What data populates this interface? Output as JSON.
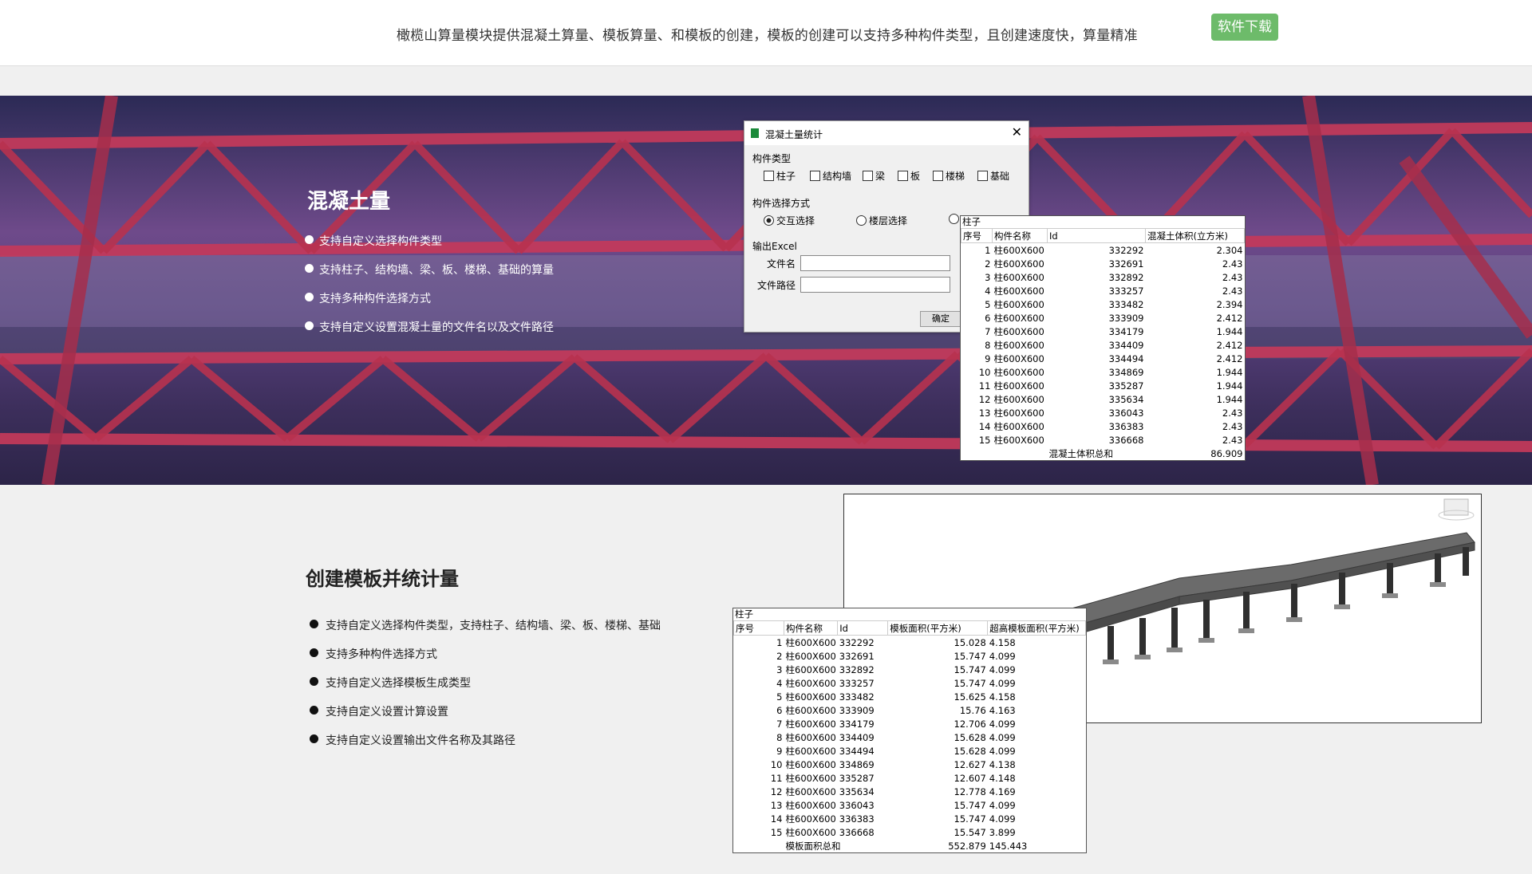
{
  "header": {
    "tagline": "橄榄山算量模块提供混凝土算量、模板算量、和模板的创建，模板的创建可以支持多种构件类型，且创建速度快，算量精准",
    "download_label": "软件下载"
  },
  "hero": {
    "title": "混凝土量",
    "features": [
      "支持自定义选择构件类型",
      "支持柱子、结构墙、梁、板、楼梯、基础的算量",
      "支持多种构件选择方式",
      "支持自定义设置混凝土量的文件名以及文件路径"
    ]
  },
  "dialog": {
    "title": "混凝土量统计",
    "group1_label": "构件类型",
    "types": [
      "柱子",
      "结构墙",
      "梁",
      "板",
      "楼梯",
      "基础"
    ],
    "group2_label": "构件选择方式",
    "modes": [
      "交互选择",
      "楼层选择",
      ""
    ],
    "group3_label": "输出Excel",
    "filename_label": "文件名",
    "filepath_label": "文件路径",
    "ok_label": "确定"
  },
  "table1": {
    "category": "柱子",
    "headers": [
      "序号",
      "构件名称",
      "Id",
      "混凝土体积(立方米)"
    ],
    "rows": [
      [
        "1",
        "柱600X600",
        "332292",
        "2.304"
      ],
      [
        "2",
        "柱600X600",
        "332691",
        "2.43"
      ],
      [
        "3",
        "柱600X600",
        "332892",
        "2.43"
      ],
      [
        "4",
        "柱600X600",
        "333257",
        "2.43"
      ],
      [
        "5",
        "柱600X600",
        "333482",
        "2.394"
      ],
      [
        "6",
        "柱600X600",
        "333909",
        "2.412"
      ],
      [
        "7",
        "柱600X600",
        "334179",
        "1.944"
      ],
      [
        "8",
        "柱600X600",
        "334409",
        "2.412"
      ],
      [
        "9",
        "柱600X600",
        "334494",
        "2.412"
      ],
      [
        "10",
        "柱600X600",
        "334869",
        "1.944"
      ],
      [
        "11",
        "柱600X600",
        "335287",
        "1.944"
      ],
      [
        "12",
        "柱600X600",
        "335634",
        "1.944"
      ],
      [
        "13",
        "柱600X600",
        "336043",
        "2.43"
      ],
      [
        "14",
        "柱600X600",
        "336383",
        "2.43"
      ],
      [
        "15",
        "柱600X600",
        "336668",
        "2.43"
      ]
    ],
    "total_label": "混凝土体积总和",
    "total_value": "86.909"
  },
  "section2": {
    "title": "创建模板并统计量",
    "features": [
      "支持自定义选择构件类型，支持柱子、结构墙、梁、板、楼梯、基础",
      "支持多种构件选择方式",
      "支持自定义选择模板生成类型",
      "支持自定义设置计算设置",
      "支持自定义设置输出文件名称及其路径"
    ]
  },
  "table2": {
    "category": "柱子",
    "headers": [
      "序号",
      "构件名称",
      "Id",
      "模板面积(平方米)",
      "超高模板面积(平方米)"
    ],
    "rows": [
      [
        "1",
        "柱600X600",
        "332292",
        "15.028",
        "4.158"
      ],
      [
        "2",
        "柱600X600",
        "332691",
        "15.747",
        "4.099"
      ],
      [
        "3",
        "柱600X600",
        "332892",
        "15.747",
        "4.099"
      ],
      [
        "4",
        "柱600X600",
        "333257",
        "15.747",
        "4.099"
      ],
      [
        "5",
        "柱600X600",
        "333482",
        "15.625",
        "4.158"
      ],
      [
        "6",
        "柱600X600",
        "333909",
        "15.76",
        "4.163"
      ],
      [
        "7",
        "柱600X600",
        "334179",
        "12.706",
        "4.099"
      ],
      [
        "8",
        "柱600X600",
        "334409",
        "15.628",
        "4.099"
      ],
      [
        "9",
        "柱600X600",
        "334494",
        "15.628",
        "4.099"
      ],
      [
        "10",
        "柱600X600",
        "334869",
        "12.627",
        "4.138"
      ],
      [
        "11",
        "柱600X600",
        "335287",
        "12.607",
        "4.148"
      ],
      [
        "12",
        "柱600X600",
        "335634",
        "12.778",
        "4.169"
      ],
      [
        "13",
        "柱600X600",
        "336043",
        "15.747",
        "4.099"
      ],
      [
        "14",
        "柱600X600",
        "336383",
        "15.747",
        "4.099"
      ],
      [
        "15",
        "柱600X600",
        "336668",
        "15.547",
        "3.899"
      ]
    ],
    "total_label": "模板面积总和",
    "total_area": "552.879",
    "total_high": "145.443"
  },
  "icons": {
    "dialog_app": "app-icon",
    "dialog_close": "close-icon",
    "bullet": "bullet-icon",
    "viewcube": "viewcube-icon"
  },
  "colors": {
    "download_button": "#6dbb6a",
    "truss": "#c43a5a",
    "hero_sky": "#6e4a8a"
  }
}
